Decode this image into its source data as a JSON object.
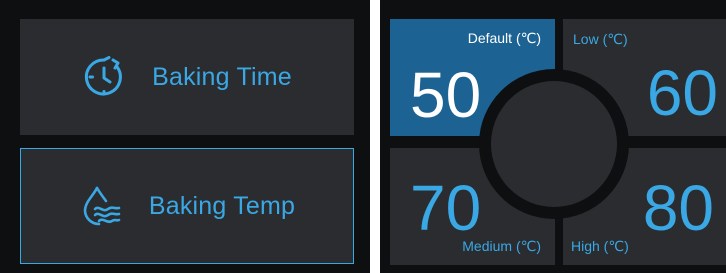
{
  "modes": {
    "time": {
      "label": "Baking Time",
      "icon": "timer-clock-icon"
    },
    "temp": {
      "label": "Baking Temp",
      "icon": "water-heat-icon",
      "selected": true
    }
  },
  "presets": {
    "default": {
      "caption": "Default (℃)",
      "value": "50",
      "selected": true
    },
    "low": {
      "caption": "Low (℃)",
      "value": "60"
    },
    "medium": {
      "caption": "Medium (℃)",
      "value": "70"
    },
    "high": {
      "caption": "High (℃)",
      "value": "80"
    }
  },
  "colors": {
    "accent": "#3aa8e4",
    "selected_tile": "#1c6394",
    "tile": "#2a2c2f",
    "background": "#0e0f11"
  }
}
